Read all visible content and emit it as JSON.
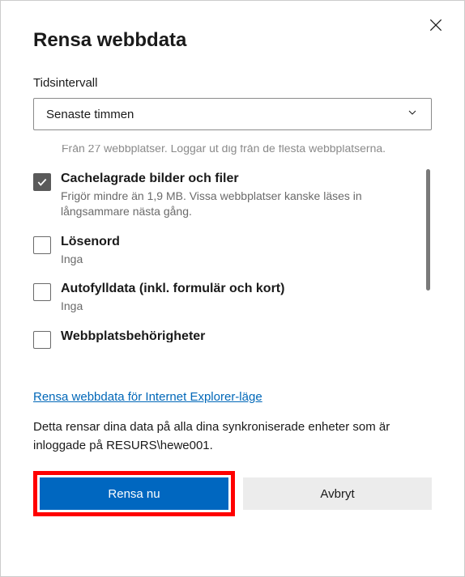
{
  "dialog": {
    "title": "Rensa webbdata",
    "time_label": "Tidsintervall",
    "time_value": "Senaste timmen",
    "items": [
      {
        "desc": "Från 27 webbplatser. Loggar ut dig från de flesta webbplatserna."
      },
      {
        "title": "Cachelagrade bilder och filer",
        "desc": "Frigör mindre än 1,9 MB. Vissa webbplatser kanske läses in långsammare nästa gång.",
        "checked": true
      },
      {
        "title": "Lösenord",
        "desc": "Inga",
        "checked": false
      },
      {
        "title": "Autofylldata (inkl. formulär och kort)",
        "desc": "Inga",
        "checked": false
      },
      {
        "title": "Webbplatsbehörigheter",
        "checked": false
      }
    ],
    "ie_link": "Rensa webbdata för Internet Explorer-läge",
    "info": "Detta rensar dina data på alla dina synkroniserade enheter som är inloggade på RESURS\\hewe001.",
    "clear_btn": "Rensa nu",
    "cancel_btn": "Avbryt"
  }
}
